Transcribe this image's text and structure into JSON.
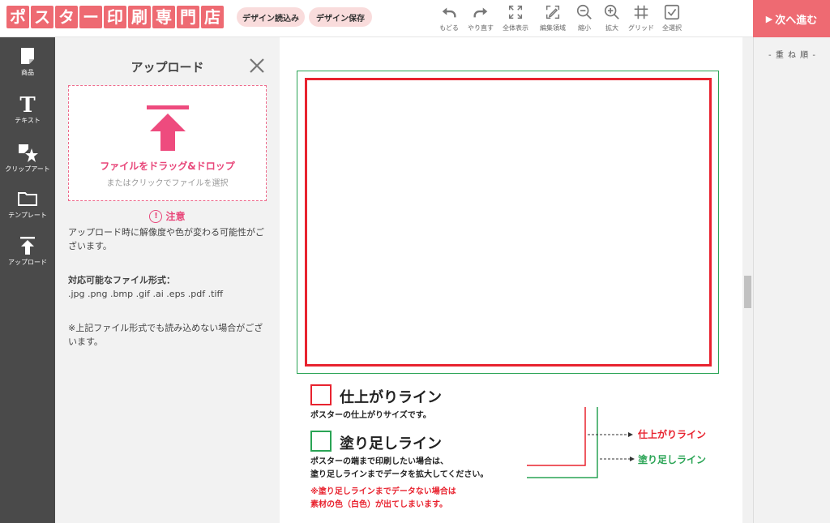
{
  "header": {
    "logo_chars": [
      "ポ",
      "ス",
      "タ",
      "ー",
      "印",
      "刷",
      "専",
      "門",
      "店"
    ],
    "load_design_label": "デザイン読込み",
    "save_design_label": "デザイン保存",
    "next_label": "次へ進む",
    "next_icon": "play-triangle-icon",
    "tools": [
      {
        "label": "もどる",
        "icon": "undo-icon"
      },
      {
        "label": "やり直す",
        "icon": "redo-icon"
      },
      {
        "label": "全体表示",
        "icon": "fit-screen-icon"
      },
      {
        "label": "編集領域",
        "icon": "edit-area-icon"
      },
      {
        "label": "縮小",
        "icon": "zoom-out-icon"
      },
      {
        "label": "拡大",
        "icon": "zoom-in-icon"
      },
      {
        "label": "グリッド",
        "icon": "grid-icon"
      },
      {
        "label": "全選択",
        "icon": "select-all-icon"
      }
    ]
  },
  "sidebar": {
    "items": [
      {
        "label": "商品",
        "icon": "product-icon"
      },
      {
        "label": "テキスト",
        "icon": "text-icon"
      },
      {
        "label": "クリップアート",
        "icon": "clipart-icon"
      },
      {
        "label": "テンプレート",
        "icon": "template-folder-icon"
      },
      {
        "label": "アップロード",
        "icon": "upload-icon"
      }
    ]
  },
  "upload_panel": {
    "title": "アップロード",
    "drop_main": "ファイルをドラッグ&ドロップ",
    "drop_sub": "またはクリックでファイルを選択",
    "warning_title": "注意",
    "warning_text": "アップロード時に解像度や色が変わる可能性がございます。",
    "formats_title": "対応可能なファイル形式：",
    "formats": ".jpg .png .bmp .gif .ai .eps .pdf .tiff",
    "note": "※上記ファイル形式でも読み込めない場合がございます。"
  },
  "canvas": {
    "finish_title": "仕上がりライン",
    "finish_desc": "ポスターの仕上がりサイズです。",
    "bleed_title": "塗り足しライン",
    "bleed_desc_1": "ポスターの端まで印刷したい場合は、",
    "bleed_desc_2": "塗り足しラインまでデータを拡大してください。",
    "bleed_warn_1": "※塗り足しラインまでデータない場合は",
    "bleed_warn_2": "素材の色（白色）が出てしまいます。",
    "diagram_finish": "仕上がりライン",
    "diagram_bleed": "塗り足しライン",
    "colors": {
      "finish": "#e8232f",
      "bleed": "#2aa455"
    }
  },
  "right_panel": {
    "layer_title": "- 重 ね 順 -"
  }
}
